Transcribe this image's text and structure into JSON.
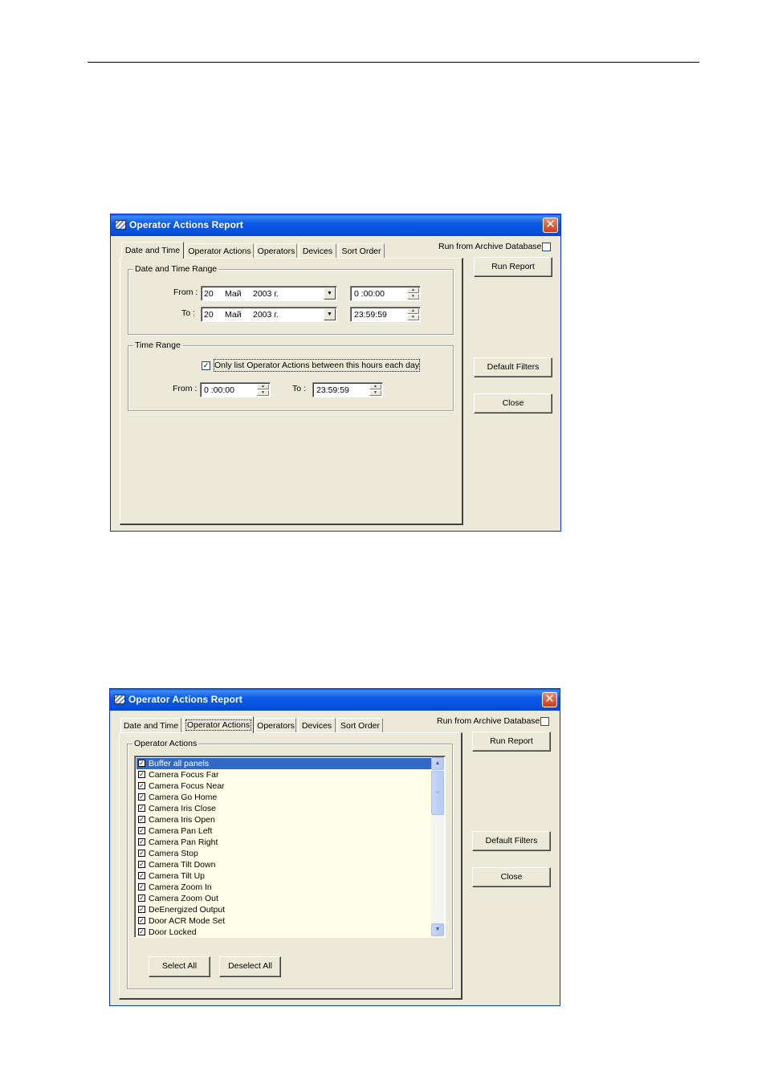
{
  "window_title": "Operator Actions Report",
  "tabs": [
    "Date and Time",
    "Operator Actions",
    "Operators",
    "Devices",
    "Sort Order"
  ],
  "archive_label": "Run from Archive Database",
  "archive_checked": false,
  "buttons": {
    "run_report": "Run Report",
    "default_filters": "Default Filters",
    "close": "Close"
  },
  "date_time": {
    "range_group": "Date and Time Range",
    "from_label": "From :",
    "to_label": "To :",
    "from_date": {
      "day": "20",
      "month": "Май",
      "year": "2003 г."
    },
    "to_date": {
      "day": "20",
      "month": "Май",
      "year": "2003 г."
    },
    "from_time": "0 :00:00",
    "to_time": "23:59:59",
    "time_group": "Time Range",
    "hours_check_label": "Only list Operator Actions between this hours each day",
    "hours_checked": true,
    "hours_from_label": "From :",
    "hours_to_label": "To :",
    "hours_from": "0 :00:00",
    "hours_to": "23:59:59"
  },
  "operator_actions": {
    "group": "Operator Actions",
    "items": [
      "Buffer all panels",
      "Camera Focus Far",
      "Camera Focus Near",
      "Camera Go Home",
      "Camera Iris Close",
      "Camera Iris Open",
      "Camera Pan Left",
      "Camera Pan Right",
      "Camera Stop",
      "Camera Tilt Down",
      "Camera Tilt Up",
      "Camera Zoom In",
      "Camera Zoom Out",
      "DeEnergized Output",
      "Door ACR Mode Set",
      "Door Locked"
    ],
    "selected_item": "Buffer all panels",
    "select_all": "Select All",
    "deselect_all": "Deselect All"
  },
  "icons": {
    "app": "report-app-icon",
    "close": "close-x-icon",
    "dropdown": "dropdown-arrow-icon",
    "check": "checkmark-icon"
  }
}
